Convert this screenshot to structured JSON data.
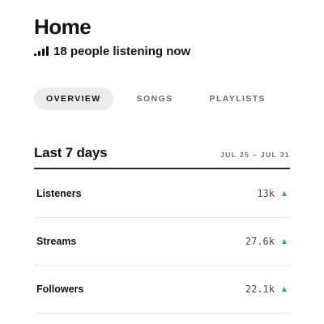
{
  "header": {
    "title": "Home",
    "listening_icon": "signal-bars-icon",
    "listening_text": "18 people listening now"
  },
  "tabs": [
    {
      "label": "OVERVIEW",
      "active": true
    },
    {
      "label": "SONGS",
      "active": false
    },
    {
      "label": "PLAYLISTS",
      "active": false
    }
  ],
  "summary": {
    "title": "Last 7 days",
    "date_range": "JUL 25 – JUL 31",
    "stats": [
      {
        "label": "Listeners",
        "value": "13k",
        "trend": "up"
      },
      {
        "label": "Streams",
        "value": "27.6k",
        "trend": "up"
      },
      {
        "label": "Followers",
        "value": "22.1k",
        "trend": "up"
      }
    ]
  },
  "colors": {
    "trend_up": "#1db954",
    "active_tab_bg": "#ececec",
    "text_primary": "#121212",
    "text_secondary": "#6a6a6a"
  }
}
